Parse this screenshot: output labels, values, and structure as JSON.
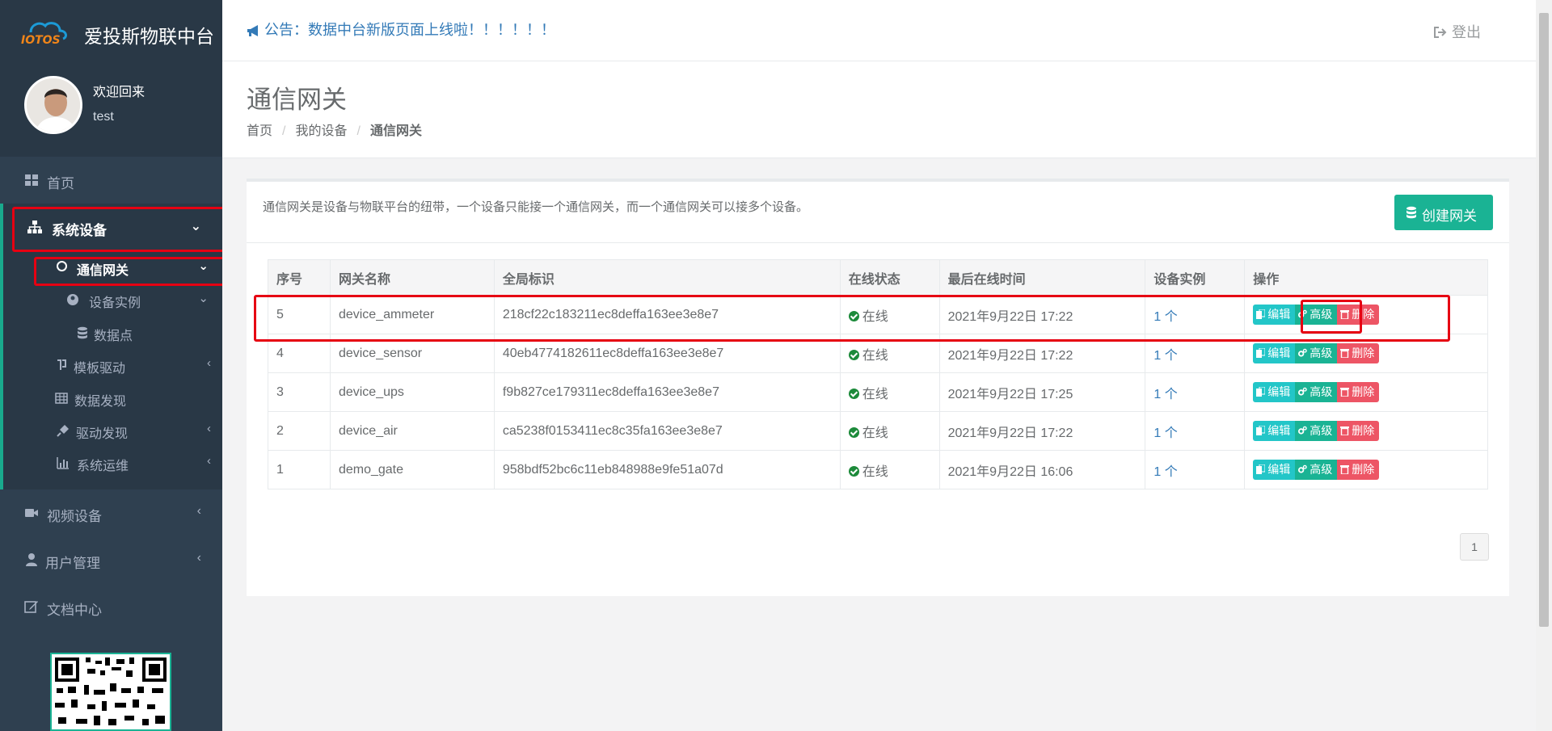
{
  "brand": {
    "logo_text": "IOTOS",
    "title": "爱投斯物联中台"
  },
  "profile": {
    "welcome": "欢迎回来",
    "username": "test"
  },
  "sidebar": {
    "home": "首页",
    "system_devices": "系统设备",
    "sub": {
      "gateway": "通信网关",
      "device_instance": "设备实例",
      "data_points": "数据点",
      "template_driver": "模板驱动",
      "data_discovery": "数据发现",
      "driver_discovery": "驱动发现",
      "system_ops": "系统运维"
    },
    "video_devices": "视频设备",
    "user_management": "用户管理",
    "docs_center": "文档中心"
  },
  "topbar": {
    "notice": "公告：数据中台新版页面上线啦！！！！！！",
    "logout": "登出"
  },
  "page": {
    "title": "通信网关",
    "breadcrumb": [
      "首页",
      "我的设备",
      "通信网关"
    ]
  },
  "panel": {
    "description": "通信网关是设备与物联平台的纽带，一个设备只能接一个通信网关，而一个通信网关可以接多个设备。",
    "create_button": "创建网关"
  },
  "table": {
    "headers": [
      "序号",
      "网关名称",
      "全局标识",
      "在线状态",
      "最后在线时间",
      "设备实例",
      "操作"
    ],
    "rows": [
      {
        "id": "5",
        "name": "device_ammeter",
        "uid": "218cf22c183211ec8deffa163ee3e8e7",
        "status": "在线",
        "last_online": "2021年9月22日 17:22",
        "instances": "1 个"
      },
      {
        "id": "4",
        "name": "device_sensor",
        "uid": "40eb4774182611ec8deffa163ee3e8e7",
        "status": "在线",
        "last_online": "2021年9月22日 17:22",
        "instances": "1 个"
      },
      {
        "id": "3",
        "name": "device_ups",
        "uid": "f9b827ce179311ec8deffa163ee3e8e7",
        "status": "在线",
        "last_online": "2021年9月22日 17:25",
        "instances": "1 个"
      },
      {
        "id": "2",
        "name": "device_air",
        "uid": "ca5238f0153411ec8c35fa163ee3e8e7",
        "status": "在线",
        "last_online": "2021年9月22日 17:22",
        "instances": "1 个"
      },
      {
        "id": "1",
        "name": "demo_gate",
        "uid": "958bdf52bc6c11eb848988e9fe51a07d",
        "status": "在线",
        "last_online": "2021年9月22日 16:06",
        "instances": "1 个"
      }
    ],
    "actions": {
      "edit": "编辑",
      "advanced": "高级",
      "delete": "删除"
    }
  },
  "pagination": {
    "current": "1"
  },
  "colors": {
    "sidebar_bg": "#2f4050",
    "accent": "#1ab394",
    "info": "#23c6c8",
    "danger": "#ed5565",
    "annotation": "#e60012"
  }
}
